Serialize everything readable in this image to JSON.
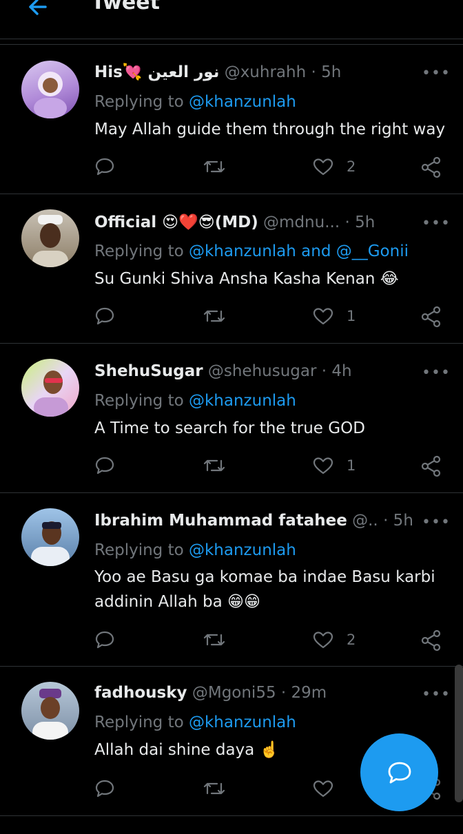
{
  "header": {
    "title": "Tweet"
  },
  "colors": {
    "accent": "#1d9bf0",
    "muted": "#71767b",
    "text": "#e7e9ea",
    "divider": "#2f3336"
  },
  "common": {
    "replying_label": "Replying to",
    "more_label": "•••"
  },
  "tweets": [
    {
      "name": "His💘 نور العين",
      "handle": "@xuhrahh",
      "time": "· 5h",
      "reply_to": "@khanzunlah",
      "text": "May Allah guide them through the right way",
      "likes": "2"
    },
    {
      "name": "Official 😍❤️😎(MD)",
      "handle": "@mdnu...",
      "time": "· 5h",
      "reply_to": "@khanzunlah and @__Gonii",
      "text": "Su Gunki Shiva Ansha Kasha Kenan 😂",
      "likes": "1"
    },
    {
      "name": "ShehuSugar",
      "handle": "@shehusugar",
      "time": "· 4h",
      "reply_to": "@khanzunlah",
      "text": "A Time to search for the true GOD",
      "likes": "1"
    },
    {
      "name": "Ibrahim Muhammad fatahee",
      "handle": "@..",
      "time": "· 5h",
      "reply_to": "@khanzunlah",
      "text": "Yoo ae Basu ga komae ba indae Basu karbi addinin Allah ba 😁😁",
      "likes": "2"
    },
    {
      "name": "fadhousky",
      "handle": "@Mgoni55",
      "time": "· 29m",
      "reply_to": "@khanzunlah",
      "text": "Allah dai shine daya ☝️",
      "likes": ""
    }
  ],
  "icons": {
    "back": "arrow-left-icon",
    "reply": "comment-icon",
    "retweet": "retweet-icon",
    "like": "heart-icon",
    "share": "share-icon",
    "compose": "compose-reply-icon"
  }
}
